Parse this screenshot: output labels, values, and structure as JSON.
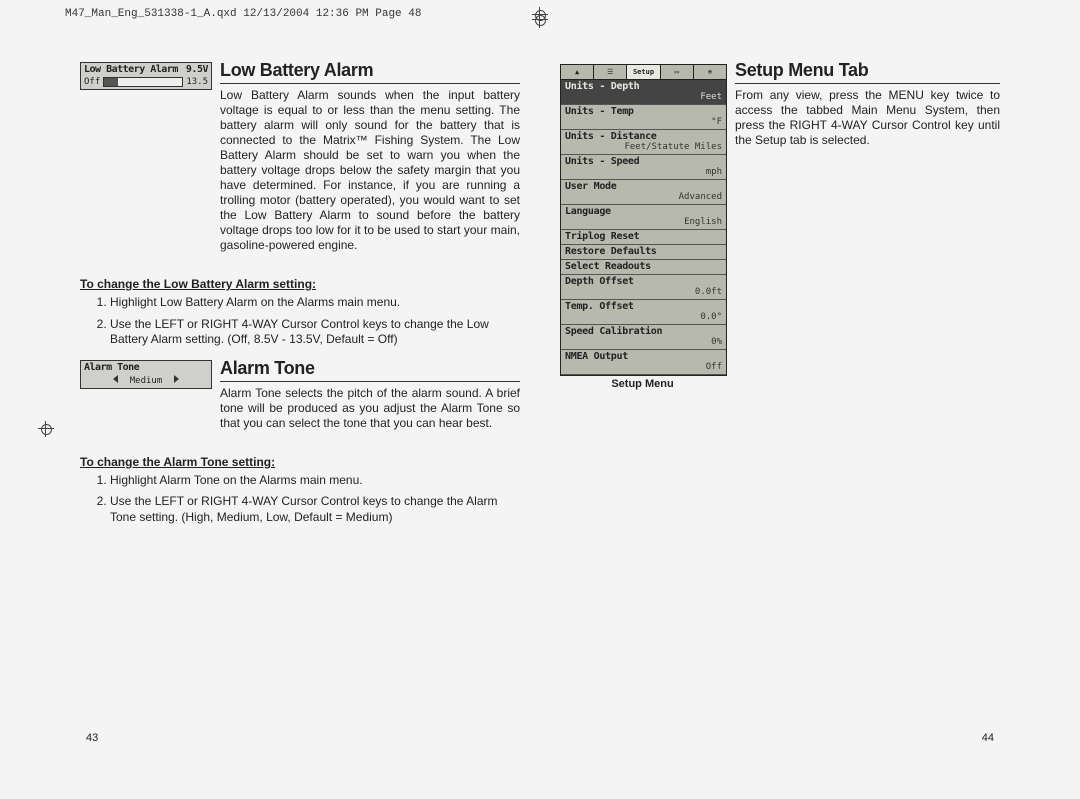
{
  "header_slugline": "M47_Man_Eng_531338-1_A.qxd  12/13/2004  12:36 PM  Page 48",
  "left_page_number": "43",
  "right_page_number": "44",
  "low_battery": {
    "heading": "Low Battery Alarm",
    "thumb_title": "Low Battery Alarm",
    "thumb_value": "9.5V",
    "thumb_min": "Off",
    "thumb_max": "13.5",
    "body": "Low Battery Alarm sounds when the input battery voltage is equal to or less than the menu setting. The battery alarm will only sound for the battery that is connected to the Matrix™ Fishing System. The Low Battery Alarm should be set to warn you when the battery voltage drops below the safety margin that you have determined. For instance, if you are running a trolling motor (battery operated), you would want to set the Low Battery Alarm to sound before the battery voltage drops too low for it to be used to start your main, gasoline-powered engine.",
    "sub_heading": "To change the Low Battery Alarm setting:",
    "steps": [
      "Highlight Low Battery Alarm on the Alarms main menu.",
      "Use the LEFT or RIGHT 4-WAY Cursor Control keys to change the Low Battery Alarm setting. (Off, 8.5V - 13.5V,  Default = Off)"
    ]
  },
  "alarm_tone": {
    "heading": "Alarm Tone",
    "thumb_title": "Alarm Tone",
    "thumb_value": "Medium",
    "body": "Alarm Tone selects the pitch of the alarm sound. A brief tone will be produced as you adjust the Alarm Tone so that you can select the tone that you can hear best.",
    "sub_heading": "To change the Alarm Tone setting:",
    "steps": [
      "Highlight Alarm Tone on the Alarms main menu.",
      "Use the LEFT or RIGHT 4-WAY Cursor Control keys to change the Alarm Tone setting. (High, Medium, Low, Default = Medium)"
    ]
  },
  "setup_menu": {
    "heading": "Setup Menu Tab",
    "body": "From any view, press the MENU key twice to access the tabbed Main Menu System, then press the RIGHT 4-WAY Cursor Control key until the Setup tab is selected.",
    "caption": "Setup Menu",
    "tabs_selected_label": "Setup",
    "items": [
      {
        "label": "Units - Depth",
        "value": "Feet",
        "selected": true
      },
      {
        "label": "Units - Temp",
        "value": "°F"
      },
      {
        "label": "Units - Distance",
        "value": "Feet/Statute Miles"
      },
      {
        "label": "Units - Speed",
        "value": "mph"
      },
      {
        "label": "User Mode",
        "value": "Advanced"
      },
      {
        "label": "Language",
        "value": "English"
      },
      {
        "label": "Triplog Reset",
        "value": ""
      },
      {
        "label": "Restore Defaults",
        "value": ""
      },
      {
        "label": "Select Readouts",
        "value": ""
      },
      {
        "label": "Depth Offset",
        "value": "0.0ft"
      },
      {
        "label": "Temp. Offset",
        "value": "0.0°"
      },
      {
        "label": "Speed Calibration",
        "value": "0%"
      },
      {
        "label": "NMEA Output",
        "value": "Off"
      }
    ]
  }
}
